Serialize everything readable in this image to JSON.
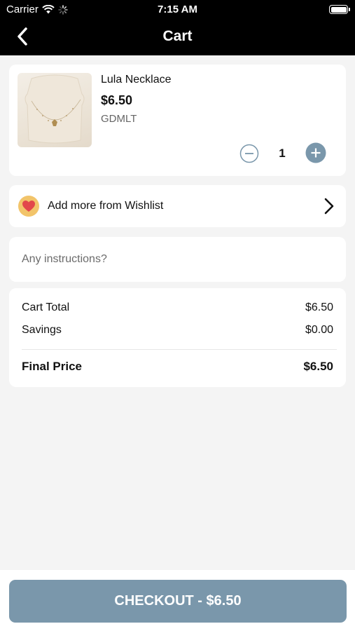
{
  "status_bar": {
    "carrier": "Carrier",
    "time": "7:15 AM",
    "icons": [
      "wifi-icon",
      "activity-spinner-icon",
      "battery-icon"
    ]
  },
  "nav": {
    "title": "Cart",
    "back_icon": "chevron-left-icon"
  },
  "cart_items": [
    {
      "name": "Lula Necklace",
      "price": "$6.50",
      "sku": "GDMLT",
      "quantity": "1",
      "image_icon": "necklace-product-image"
    }
  ],
  "wishlist": {
    "label": "Add more from Wishlist",
    "icon": "heart-icon",
    "chevron_icon": "chevron-right-icon"
  },
  "instructions": {
    "placeholder": "Any instructions?",
    "value": ""
  },
  "summary": {
    "cart_total_label": "Cart Total",
    "cart_total_value": "$6.50",
    "savings_label": "Savings",
    "savings_value": "$0.00",
    "final_price_label": "Final Price",
    "final_price_value": "$6.50"
  },
  "checkout": {
    "label": "CHECKOUT - $6.50"
  },
  "colors": {
    "header_bg": "#000000",
    "page_bg": "#f4f4f4",
    "accent": "#7a97ab",
    "wishlist_icon_bg": "#f2c46a",
    "heart": "#e2474b"
  }
}
